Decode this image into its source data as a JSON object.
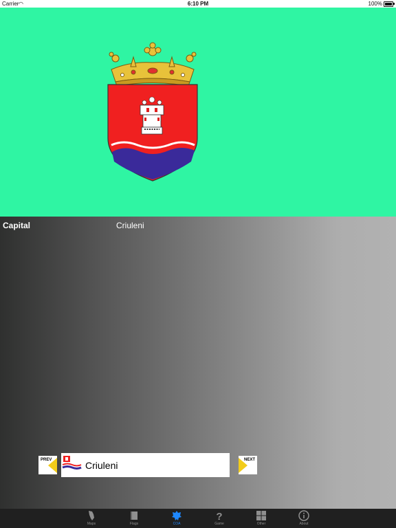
{
  "status_bar": {
    "carrier": "Carrier",
    "time": "6:10 PM",
    "battery": "100%"
  },
  "colors": {
    "coa_background": "#2ff5a3",
    "accent": "#f2cc1a",
    "tab_active": "#1e88ff"
  },
  "info": {
    "key": "Capital",
    "value": "Criuleni"
  },
  "nav": {
    "prev_label": "PREV",
    "next_label": "NEXT",
    "current_name": "Criuleni"
  },
  "tabs": [
    {
      "label": "Maps",
      "icon": "map-icon",
      "active": false
    },
    {
      "label": "Flags",
      "icon": "flag-icon",
      "active": false
    },
    {
      "label": "COA",
      "icon": "coat-of-arms-icon",
      "active": true
    },
    {
      "label": "Game",
      "icon": "question-mark-icon",
      "active": false
    },
    {
      "label": "Other",
      "icon": "grid-icon",
      "active": false
    },
    {
      "label": "About",
      "icon": "info-icon",
      "active": false
    }
  ]
}
